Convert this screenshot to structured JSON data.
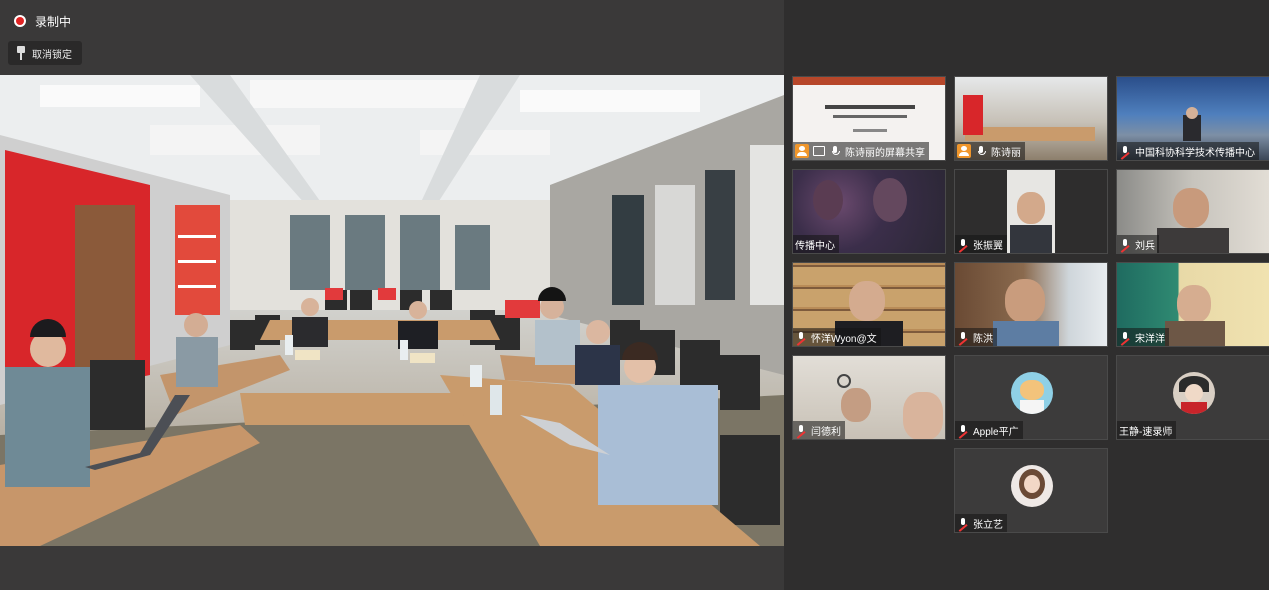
{
  "topbar": {
    "recording_label": "录制中",
    "unpin_label": "取消锁定"
  },
  "gallery": {
    "tiles": [
      {
        "name": "陈诗丽的屏幕共享",
        "muted": false,
        "host": true,
        "sharing": true
      },
      {
        "name": "陈诗丽",
        "muted": false,
        "host": true
      },
      {
        "name": "中国科协科学技术传播中心",
        "muted": true
      },
      {
        "name": "传播中心",
        "muted": null
      },
      {
        "name": "张振翼",
        "muted": true
      },
      {
        "name": "刘兵",
        "muted": true
      },
      {
        "name": "怀洋Wyon@文",
        "muted": true
      },
      {
        "name": "陈洪",
        "muted": true
      },
      {
        "name": "宋洋洋",
        "muted": true
      },
      {
        "name": "闫德利",
        "muted": true
      },
      {
        "name": "Apple平广",
        "muted": true
      },
      {
        "name": "王静-速录师",
        "muted": null
      },
      {
        "name": "张立艺",
        "muted": true
      }
    ]
  },
  "icons": [
    "record-icon",
    "pin-icon",
    "mic-muted-icon",
    "mic-icon",
    "host-icon",
    "screen-share-icon",
    "menu-icon"
  ],
  "colors": {
    "record": "#e02424",
    "host": "#f0962b",
    "background": "#3a3939",
    "gallery": "#2f2e2e"
  }
}
